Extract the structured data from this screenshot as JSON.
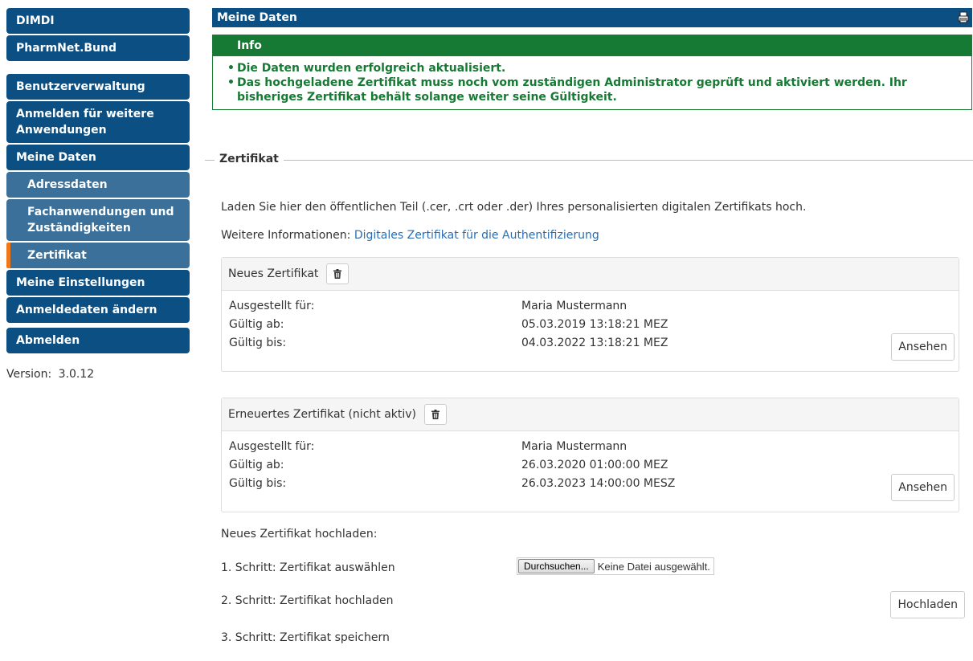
{
  "sidebar": {
    "items": [
      {
        "label": "DIMDI"
      },
      {
        "label": "PharmNet.Bund"
      },
      {
        "label": "Benutzerverwaltung"
      },
      {
        "label": "Anmelden für weitere Anwendungen"
      },
      {
        "label": "Meine Daten"
      },
      {
        "label": "Adressdaten"
      },
      {
        "label": "Fachanwendungen und Zuständigkeiten"
      },
      {
        "label": "Zertifikat"
      },
      {
        "label": "Meine Einstellungen"
      },
      {
        "label": "Anmeldedaten ändern"
      },
      {
        "label": "Abmelden"
      }
    ],
    "version_label": "Version:",
    "version_value": "3.0.12"
  },
  "main": {
    "title": "Meine Daten",
    "info": {
      "heading": "Info",
      "messages": [
        "Die Daten wurden erfolgreich aktualisiert.",
        "Das hochgeladene Zertifikat muss noch vom zuständigen Administrator geprüft und aktiviert werden. Ihr bisheriges Zertifikat behält solange weiter seine Gültigkeit."
      ]
    },
    "section_title": "Zertifikat",
    "intro": "Laden Sie hier den öffentlichen Teil (.cer, .crt oder .der) Ihres personalisierten digitalen Zertifikats hoch.",
    "more_info_label": "Weitere Informationen:",
    "more_info_link": "Digitales Zertifikat für die Authentifizierung",
    "certs": [
      {
        "title": "Neues Zertifikat",
        "issued_for_label": "Ausgestellt für:",
        "issued_for": "Maria Mustermann",
        "valid_from_label": "Gültig ab:",
        "valid_from": "05.03.2019 13:18:21 MEZ",
        "valid_to_label": "Gültig bis:",
        "valid_to": "04.03.2022 13:18:21 MEZ",
        "view_button": "Ansehen"
      },
      {
        "title": "Erneuertes Zertifikat (nicht aktiv)",
        "issued_for_label": "Ausgestellt für:",
        "issued_for": "Maria Mustermann",
        "valid_from_label": "Gültig ab:",
        "valid_from": "26.03.2020 01:00:00 MEZ",
        "valid_to_label": "Gültig bis:",
        "valid_to": "26.03.2023 14:00:00 MESZ",
        "view_button": "Ansehen"
      }
    ],
    "upload": {
      "heading": "Neues Zertifikat hochladen:",
      "step1": "1. Schritt: Zertifikat auswählen",
      "step2": "2. Schritt: Zertifikat hochladen",
      "step3": "3. Schritt: Zertifikat speichern",
      "browse_button": "Durchsuchen...",
      "no_file": "Keine Datei ausgewählt.",
      "upload_button": "Hochladen"
    }
  },
  "colors": {
    "nav_primary": "#0c4f82",
    "nav_sub": "#3a7099",
    "active_marker": "#f07819",
    "info_green": "#167a34",
    "link": "#2b6db2"
  }
}
